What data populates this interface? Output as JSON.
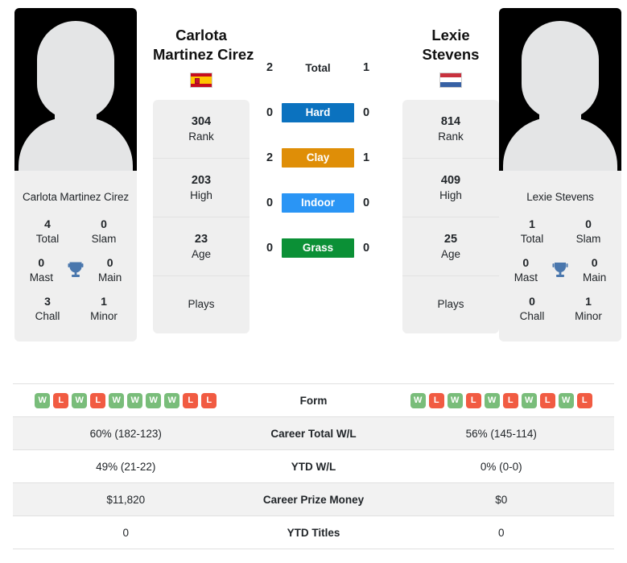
{
  "players": {
    "left": {
      "name_line1": "Carlota",
      "name_line2": "Martinez Cirez",
      "full_name": "Carlota Martinez Cirez",
      "flag": "spain-flag-icon",
      "rank": "304",
      "rank_label": "Rank",
      "high": "203",
      "high_label": "High",
      "age": "23",
      "age_label": "Age",
      "plays_label": "Plays",
      "plays_value": "",
      "titles": {
        "total": "4",
        "total_label": "Total",
        "slam": "0",
        "slam_label": "Slam",
        "mast": "0",
        "mast_label": "Mast",
        "main": "0",
        "main_label": "Main",
        "chall": "3",
        "chall_label": "Chall",
        "minor": "1",
        "minor_label": "Minor"
      },
      "form": [
        "W",
        "L",
        "W",
        "L",
        "W",
        "W",
        "W",
        "W",
        "L",
        "L"
      ],
      "career_wl": "60% (182-123)",
      "ytd_wl": "49% (21-22)",
      "career_prize": "$11,820",
      "ytd_titles": "0"
    },
    "right": {
      "name_line1": "Lexie",
      "name_line2": "Stevens",
      "full_name": "Lexie Stevens",
      "flag": "netherlands-flag-icon",
      "rank": "814",
      "rank_label": "Rank",
      "high": "409",
      "high_label": "High",
      "age": "25",
      "age_label": "Age",
      "plays_label": "Plays",
      "plays_value": "",
      "titles": {
        "total": "1",
        "total_label": "Total",
        "slam": "0",
        "slam_label": "Slam",
        "mast": "0",
        "mast_label": "Mast",
        "main": "0",
        "main_label": "Main",
        "chall": "0",
        "chall_label": "Chall",
        "minor": "1",
        "minor_label": "Minor"
      },
      "form": [
        "W",
        "L",
        "W",
        "L",
        "W",
        "L",
        "W",
        "L",
        "W",
        "L"
      ],
      "career_wl": "56% (145-114)",
      "ytd_wl": "0% (0-0)",
      "career_prize": "$0",
      "ytd_titles": "0"
    }
  },
  "head_to_head": {
    "rows": [
      {
        "label": "Total",
        "left": "2",
        "right": "1",
        "color": ""
      },
      {
        "label": "Hard",
        "left": "0",
        "right": "0",
        "color": "#0b72bf"
      },
      {
        "label": "Clay",
        "left": "2",
        "right": "1",
        "color": "#df8e07"
      },
      {
        "label": "Indoor",
        "left": "0",
        "right": "0",
        "color": "#2a95f5"
      },
      {
        "label": "Grass",
        "left": "0",
        "right": "0",
        "color": "#0b9036"
      }
    ]
  },
  "comparison_table": {
    "rows": [
      {
        "label": "Form",
        "type": "form"
      },
      {
        "label": "Career Total W/L",
        "type": "text",
        "key": "career_wl"
      },
      {
        "label": "YTD W/L",
        "type": "text",
        "key": "ytd_wl"
      },
      {
        "label": "Career Prize Money",
        "type": "text",
        "key": "career_prize"
      },
      {
        "label": "YTD Titles",
        "type": "text",
        "key": "ytd_titles"
      }
    ]
  },
  "colors": {
    "hard": "#0b72bf",
    "clay": "#df8e07",
    "indoor": "#2a95f5",
    "grass": "#0b9036",
    "win": "#79bd7a",
    "loss": "#f15b42",
    "trophy": "#4a77ad",
    "panel": "#efefef"
  }
}
